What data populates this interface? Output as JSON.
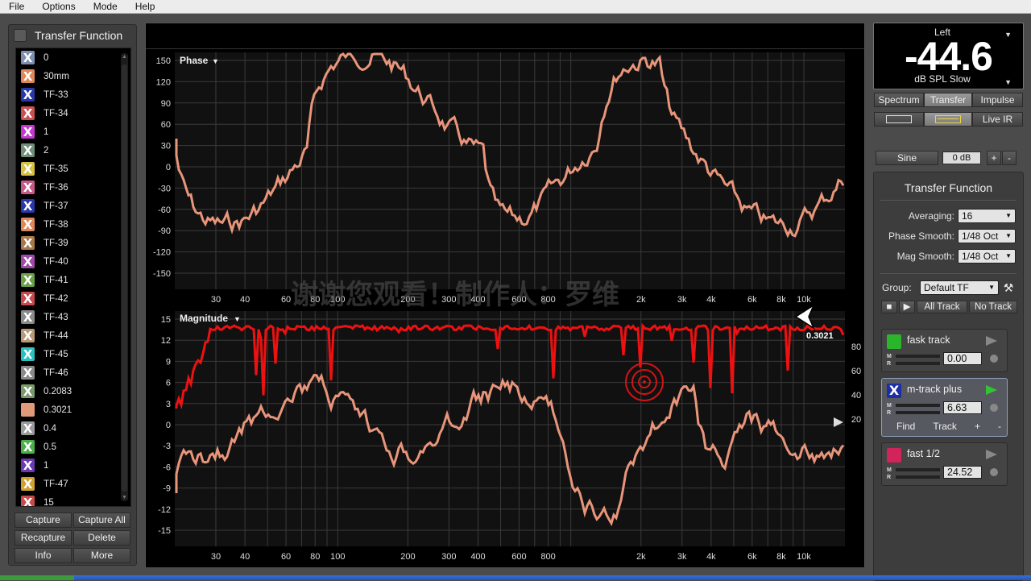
{
  "menu": [
    "File",
    "Options",
    "Mode",
    "Help"
  ],
  "left_panel": {
    "title": "Transfer Function",
    "items": [
      {
        "label": "0",
        "color": "#7f8fb0",
        "x": true
      },
      {
        "label": "30mm",
        "color": "#e0875a",
        "x": true
      },
      {
        "label": "TF-33",
        "color": "#2a37a8",
        "x": true
      },
      {
        "label": "TF-34",
        "color": "#c85050",
        "x": true
      },
      {
        "label": "1",
        "color": "#c43ad0",
        "x": true
      },
      {
        "label": "2",
        "color": "#6f8f7a",
        "x": true
      },
      {
        "label": "TF-35",
        "color": "#d8c040",
        "x": true
      },
      {
        "label": "TF-36",
        "color": "#c85a8a",
        "x": true
      },
      {
        "label": "TF-37",
        "color": "#2a37a8",
        "x": true
      },
      {
        "label": "TF-38",
        "color": "#e0875a",
        "x": true
      },
      {
        "label": "TF-39",
        "color": "#a8784a",
        "x": true
      },
      {
        "label": "TF-40",
        "color": "#a04aa8",
        "x": true
      },
      {
        "label": "TF-41",
        "color": "#6aa04a",
        "x": true
      },
      {
        "label": "TF-42",
        "color": "#c84a4a",
        "x": true
      },
      {
        "label": "TF-43",
        "color": "#8a8a8a",
        "x": true
      },
      {
        "label": "TF-44",
        "color": "#b89a7a",
        "x": true
      },
      {
        "label": "TF-45",
        "color": "#2ac0c0",
        "x": true
      },
      {
        "label": "TF-46",
        "color": "#8a8a8a",
        "x": true
      },
      {
        "label": "0.2083",
        "color": "#7a9a6a",
        "x": true
      },
      {
        "label": "0.3021",
        "color": "#e09a7a",
        "x": false
      },
      {
        "label": "0.4",
        "color": "#9a9a9a",
        "x": true
      },
      {
        "label": "0.5",
        "color": "#4ab04a",
        "x": true
      },
      {
        "label": "1",
        "color": "#6a3ab0",
        "x": true
      },
      {
        "label": "TF-47",
        "color": "#d0a030",
        "x": true
      },
      {
        "label": "15",
        "color": "#c84a4a",
        "x": true
      }
    ],
    "buttons": {
      "capture": "Capture",
      "capture_all": "Capture All",
      "recapture": "Recapture",
      "delete": "Delete",
      "info": "Info",
      "more": "More"
    }
  },
  "phase_plot": {
    "label": "Phase",
    "y_ticks": [
      "150",
      "120",
      "90",
      "60",
      "30",
      "0",
      "-30",
      "-60",
      "-90",
      "-120",
      "-150"
    ],
    "x_ticks": [
      "30",
      "40",
      "60",
      "80",
      "100",
      "200",
      "300",
      "400",
      "600",
      "800",
      "2k",
      "3k",
      "4k",
      "6k",
      "8k",
      "10k"
    ]
  },
  "magnitude_plot": {
    "label": "Magnitude",
    "y_ticks": [
      "15",
      "12",
      "9",
      "6",
      "3",
      "0",
      "-3",
      "-6",
      "-9",
      "-12",
      "-15"
    ],
    "y_ticks_right": [
      "80",
      "60",
      "40",
      "20"
    ],
    "x_ticks": [
      "30",
      "40",
      "60",
      "80",
      "100",
      "200",
      "300",
      "400",
      "600",
      "800",
      "2k",
      "3k",
      "4k",
      "6k",
      "8k",
      "10k"
    ],
    "trace_label": "0.3021"
  },
  "watermark": "谢谢您观看！制作人：罗维",
  "meter": {
    "channel": "Left",
    "value": "-44.6",
    "unit": "dB SPL Slow"
  },
  "mode_tabs": [
    "Spectrum",
    "Transfer",
    "Impulse"
  ],
  "live_ir": "Live IR",
  "signal": {
    "type": "Sine",
    "level": "0 dB",
    "plus": "+",
    "minus": "-"
  },
  "tf_panel": {
    "title": "Transfer Function",
    "averaging_label": "Averaging:",
    "averaging": "16",
    "phase_smooth_label": "Phase Smooth:",
    "phase_smooth": "1/48 Oct",
    "mag_smooth_label": "Mag Smooth:",
    "mag_smooth": "1/48 Oct",
    "group_label": "Group:",
    "group": "Default TF",
    "all_track": "All Track",
    "no_track": "No Track"
  },
  "tracks": [
    {
      "name": "fask track",
      "value": "0.00",
      "color": "#2bb52b",
      "selected": false
    },
    {
      "name": "m-track plus",
      "value": "6.63",
      "color": "#1d2ea5",
      "selected": true,
      "find": "Find",
      "track": "Track",
      "plus": "+",
      "minus": "-"
    },
    {
      "name": "fast 1/2",
      "value": "24.52",
      "color": "#d0245a",
      "selected": false
    }
  ],
  "colors": {
    "trace_salmon": "#e8957a",
    "trace_red": "#ee1111",
    "grid": "#3a3a3a"
  }
}
